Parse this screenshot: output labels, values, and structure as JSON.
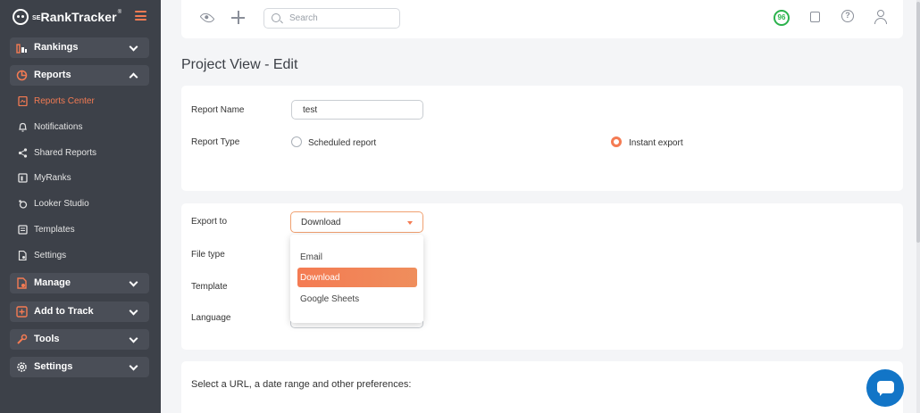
{
  "brand": {
    "name_small": "SE",
    "name": "RankTracker",
    "sup": "®",
    "accent": "#f47b53"
  },
  "sidebar": {
    "groups": [
      {
        "label": "Rankings",
        "expanded": false
      },
      {
        "label": "Reports",
        "expanded": true
      },
      {
        "label": "Manage",
        "expanded": false
      },
      {
        "label": "Add to Track",
        "expanded": false
      },
      {
        "label": "Tools",
        "expanded": false
      },
      {
        "label": "Settings",
        "expanded": false
      }
    ],
    "report_items": [
      {
        "label": "Reports Center",
        "active": true
      },
      {
        "label": "Notifications"
      },
      {
        "label": "Shared Reports"
      },
      {
        "label": "MyRanks"
      },
      {
        "label": "Looker Studio"
      },
      {
        "label": "Templates"
      },
      {
        "label": "Settings"
      }
    ]
  },
  "topbar": {
    "search_placeholder": "Search",
    "score": "96",
    "score_color": "#2bb24c"
  },
  "page_title": "Project View - Edit",
  "report": {
    "name_label": "Report Name",
    "name_value": "test",
    "type_label": "Report Type",
    "type_options": [
      {
        "label": "Scheduled report",
        "checked": false
      },
      {
        "label": "Instant export",
        "checked": true
      }
    ]
  },
  "export": {
    "export_to_label": "Export to",
    "export_to_value": "Download",
    "file_type_label": "File type",
    "template_label": "Template",
    "language_label": "Language",
    "options": [
      "Email",
      "Download",
      "Google Sheets"
    ],
    "selected": "Download"
  },
  "preferences": {
    "title": "Select a URL, a date range and other preferences:"
  }
}
